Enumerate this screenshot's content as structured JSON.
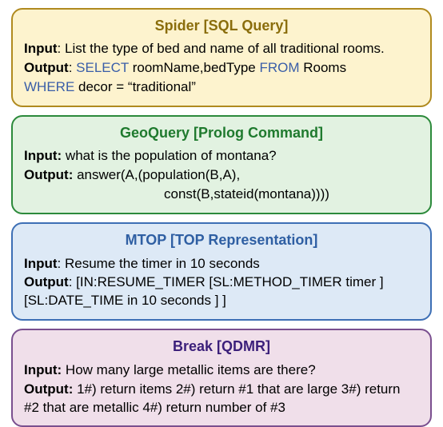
{
  "cards": {
    "spider": {
      "title": "Spider [SQL Query]",
      "input_label": "Input",
      "input_text": ": List the type of bed and name of all traditional rooms.",
      "output_label": "Output",
      "output_prefix": ": ",
      "select_kw": "SELECT",
      "select_cols": " roomName,bedType ",
      "from_kw": "FROM",
      "from_tbl": " Rooms",
      "where_kw": "WHERE",
      "where_clause": " decor = “traditional”"
    },
    "geoquery": {
      "title": "GeoQuery [Prolog Command]",
      "input_label": "Input:",
      "input_text": " what is the population of montana?",
      "output_label": "Output:",
      "output_line1": " answer(A,(population(B,A),",
      "output_line2": "const(B,stateid(montana))))"
    },
    "mtop": {
      "title": "MTOP [TOP Representation]",
      "input_label": "Input",
      "input_text": ": Resume the timer in 10 seconds",
      "output_label": "Output",
      "output_text": ": [IN:RESUME_TIMER [SL:METHOD_TIMER timer ] [SL:DATE_TIME in 10 seconds ] ]"
    },
    "break": {
      "title": "Break [QDMR]",
      "input_label": "Input:",
      "input_text": " How many large metallic items are there?",
      "output_label": "Output:",
      "output_text": " 1#) return items 2#) return #1 that are large 3#) return #2 that are metallic 4#) return number of #3"
    }
  }
}
